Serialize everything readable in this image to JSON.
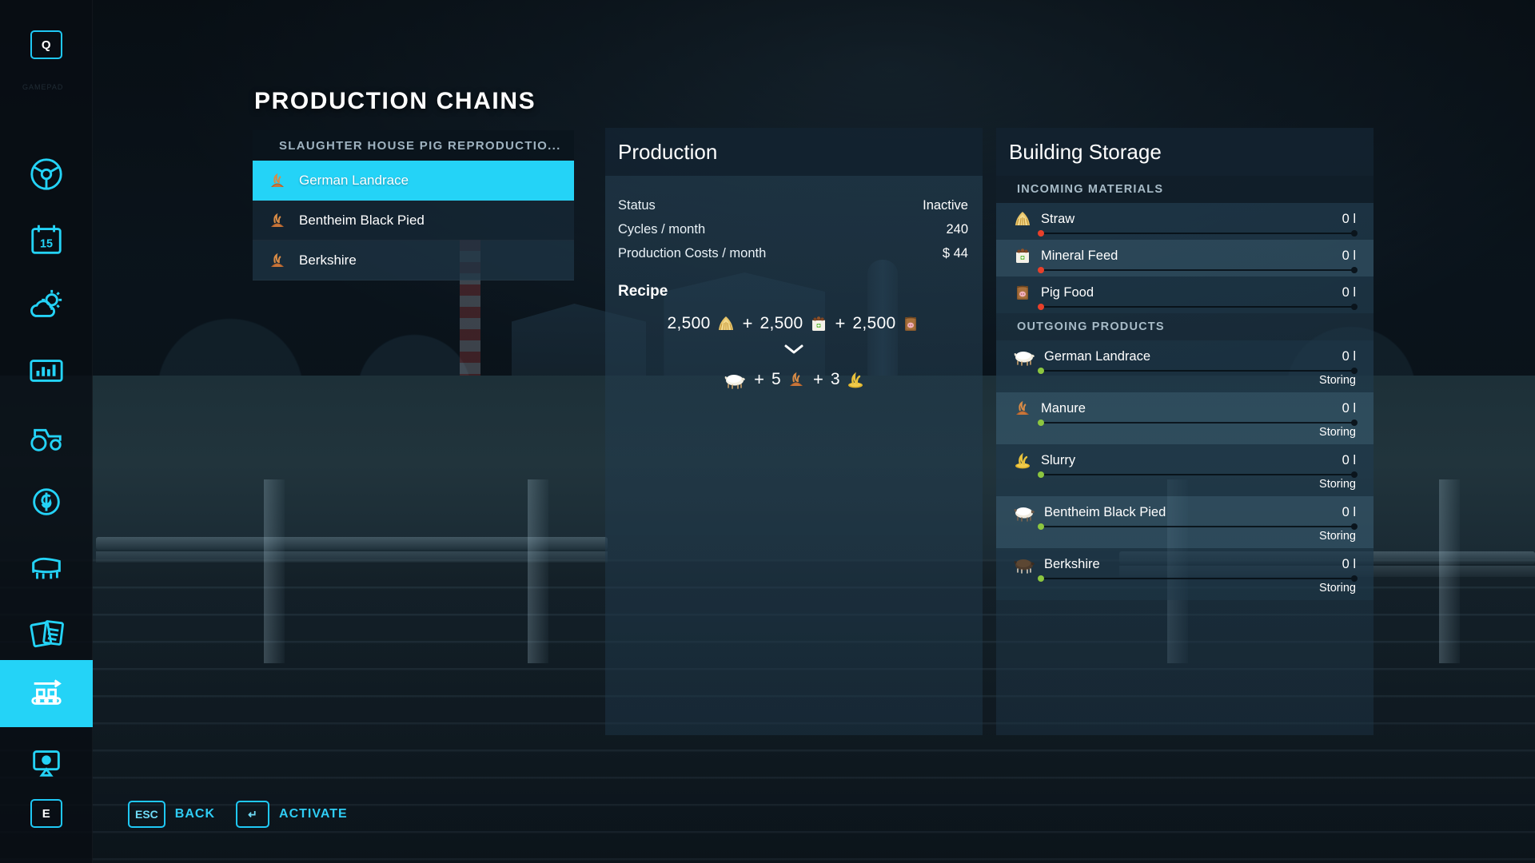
{
  "page": {
    "title": "PRODUCTION CHAINS"
  },
  "rail": {
    "key_top": "Q",
    "key_bottom": "E",
    "items": [
      {
        "icon": "steering-wheel-icon",
        "active": false
      },
      {
        "icon": "calendar-icon",
        "label": "15",
        "active": false
      },
      {
        "icon": "weather-icon",
        "active": false
      },
      {
        "icon": "statistics-icon",
        "active": false
      },
      {
        "icon": "tractor-icon",
        "active": false
      },
      {
        "icon": "finances-icon",
        "active": false
      },
      {
        "icon": "animals-icon",
        "active": false
      },
      {
        "icon": "contracts-icon",
        "active": false
      },
      {
        "icon": "production-chains-icon",
        "active": true
      },
      {
        "icon": "map-overview-icon",
        "active": false
      }
    ]
  },
  "list": {
    "header": "SLAUGHTER HOUSE PIG REPRODUCTIO...",
    "rows": [
      {
        "label": "German Landrace",
        "icon": "manure-icon",
        "selected": true
      },
      {
        "label": "Bentheim Black Pied",
        "icon": "manure-icon",
        "selected": false
      },
      {
        "label": "Berkshire",
        "icon": "manure-icon",
        "selected": false
      }
    ]
  },
  "production": {
    "title": "Production",
    "stats": [
      {
        "key": "Status",
        "value": "Inactive"
      },
      {
        "key": "Cycles / month",
        "value": "240"
      },
      {
        "key": "Production Costs / month",
        "value": "$ 44"
      }
    ],
    "recipe_title": "Recipe",
    "recipe_inputs": [
      {
        "amount": "2,500",
        "icon": "straw-icon"
      },
      {
        "amount": "2,500",
        "icon": "mineral-feed-icon"
      },
      {
        "amount": "2,500",
        "icon": "pig-food-icon"
      }
    ],
    "recipe_outputs": [
      {
        "amount": "",
        "icon": "pig-icon"
      },
      {
        "amount": "5",
        "icon": "manure-icon"
      },
      {
        "amount": "3",
        "icon": "slurry-icon"
      }
    ],
    "plus": "+"
  },
  "storage": {
    "title": "Building Storage",
    "incoming_header": "INCOMING MATERIALS",
    "outgoing_header": "OUTGOING PRODUCTS",
    "incoming": [
      {
        "name": "Straw",
        "amount": "0 l",
        "icon": "straw-icon",
        "dot": "#e8402a",
        "fill": 0
      },
      {
        "name": "Mineral Feed",
        "amount": "0 l",
        "icon": "mineral-feed-icon",
        "dot": "#e8402a",
        "fill": 0
      },
      {
        "name": "Pig Food",
        "amount": "0 l",
        "icon": "pig-food-icon",
        "dot": "#e8402a",
        "fill": 0
      }
    ],
    "outgoing": [
      {
        "name": "German Landrace",
        "amount": "0 l",
        "icon": "pig-icon",
        "dot": "#8cc63f",
        "status": "Storing",
        "fill": 0
      },
      {
        "name": "Manure",
        "amount": "0 l",
        "icon": "manure-icon",
        "dot": "#8cc63f",
        "status": "Storing",
        "fill": 0
      },
      {
        "name": "Slurry",
        "amount": "0 l",
        "icon": "slurry-icon",
        "dot": "#8cc63f",
        "status": "Storing",
        "fill": 0
      },
      {
        "name": "Bentheim Black Pied",
        "amount": "0 l",
        "icon": "pig-icon",
        "dot": "#8cc63f",
        "status": "Storing",
        "fill": 0
      },
      {
        "name": "Berkshire",
        "amount": "0 l",
        "icon": "pig-dark-icon",
        "dot": "#8cc63f",
        "status": "Storing",
        "fill": 0
      }
    ]
  },
  "footer": {
    "hints": [
      {
        "key": "ESC",
        "label": "BACK"
      },
      {
        "key": "↵",
        "label": "ACTIVATE"
      }
    ]
  },
  "colors": {
    "accent": "#24d3f7",
    "accent_text": "#2fcdf5",
    "panel": "#243e50",
    "ok": "#8cc63f",
    "warn": "#e8402a"
  }
}
